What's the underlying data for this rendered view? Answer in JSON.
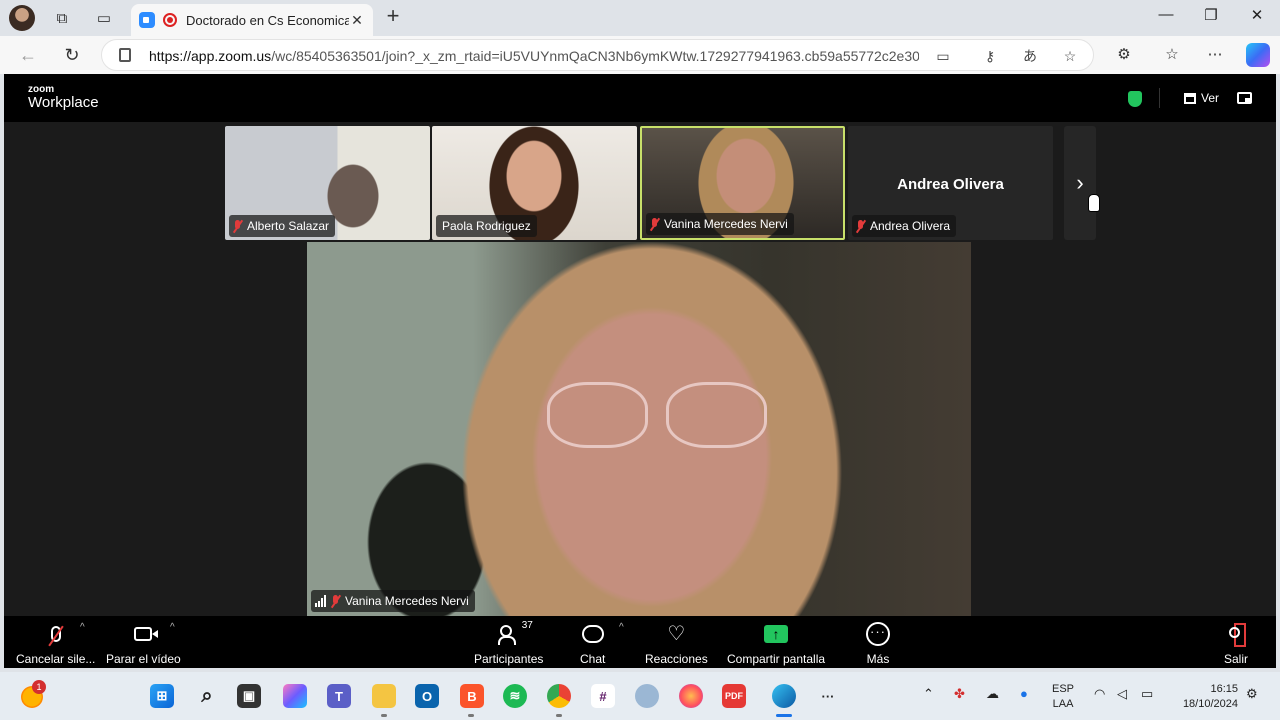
{
  "browser": {
    "tab_title": "Doctorado en Cs Economica",
    "tab_close": "✕",
    "new_tab": "+",
    "url_domain": "https://app.zoom.us",
    "url_path": "/wc/85405363501/join?_x_zm_rtaid=iU5VUYnmQaCN3Nb6ymKWtw.1729277941963.cb59a55772c2e30...",
    "window_controls": [
      "—",
      "❐",
      "✕"
    ]
  },
  "zoom": {
    "logo_top": "zoom",
    "logo_bottom": "Workplace",
    "view_label": "Ver",
    "participants": [
      {
        "name": "Alberto Salazar",
        "muted": true
      },
      {
        "name": "Paola Rodriguez",
        "muted": false
      },
      {
        "name": "Vanina Mercedes Nervi",
        "muted": true
      },
      {
        "name": "Andrea Olivera",
        "muted": true,
        "video_off": true
      }
    ],
    "video_off_name": "Andrea Olivera",
    "active_speaker": "Vanina Mercedes Nervi",
    "controls": {
      "mute": "Cancelar sile...",
      "video": "Parar el vídeo",
      "participants": "Participantes",
      "participants_count": "37",
      "chat": "Chat",
      "reactions": "Reacciones",
      "share": "Compartir pantalla",
      "more": "Más",
      "leave": "Salir"
    }
  },
  "taskbar": {
    "weather_badge": "1",
    "language_line1": "ESP",
    "language_line2": "LAA",
    "time": "16:15",
    "date": "18/10/2024"
  },
  "colors": {
    "zoom_blue": "#2d8cff",
    "active_border": "#c8e06a",
    "muted_red": "#e23b3b",
    "share_green": "#22c55e"
  }
}
